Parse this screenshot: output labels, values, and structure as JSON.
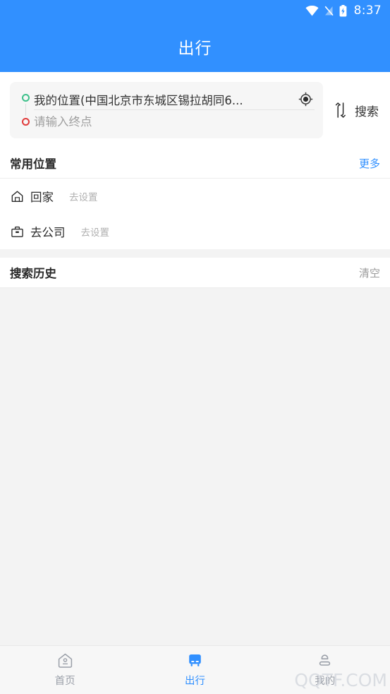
{
  "status_bar": {
    "time": "8:37",
    "icons": [
      "wifi-icon",
      "signal-off-icon",
      "battery-charging-icon"
    ]
  },
  "header": {
    "title": "出行"
  },
  "search_card": {
    "origin": {
      "value": "我的位置(中国北京市东城区锡拉胡同6...",
      "dot_color": "#3dc08a",
      "locate_icon": "gps-target-icon"
    },
    "destination": {
      "value": "",
      "placeholder": "请输入终点",
      "dot_color": "#e03b3b"
    },
    "swap_icon": "swap-vertical-icon",
    "search_label": "搜索"
  },
  "frequent_section": {
    "title": "常用位置",
    "action_label": "更多",
    "action_color": "#3190ff",
    "items": [
      {
        "icon": "home-icon",
        "label": "回家",
        "hint": "去设置"
      },
      {
        "icon": "briefcase-icon",
        "label": "去公司",
        "hint": "去设置"
      }
    ]
  },
  "history_section": {
    "title": "搜索历史",
    "action_label": "清空",
    "items": []
  },
  "bottom_nav": {
    "active_color": "#3190ff",
    "inactive_color": "#9a9fa8",
    "items": [
      {
        "icon": "home-outline-icon",
        "label": "首页",
        "active": false
      },
      {
        "icon": "bus-icon",
        "label": "出行",
        "active": true
      },
      {
        "icon": "person-icon",
        "label": "我的",
        "active": false
      }
    ]
  },
  "watermark": {
    "text": "QQTF.COM"
  }
}
